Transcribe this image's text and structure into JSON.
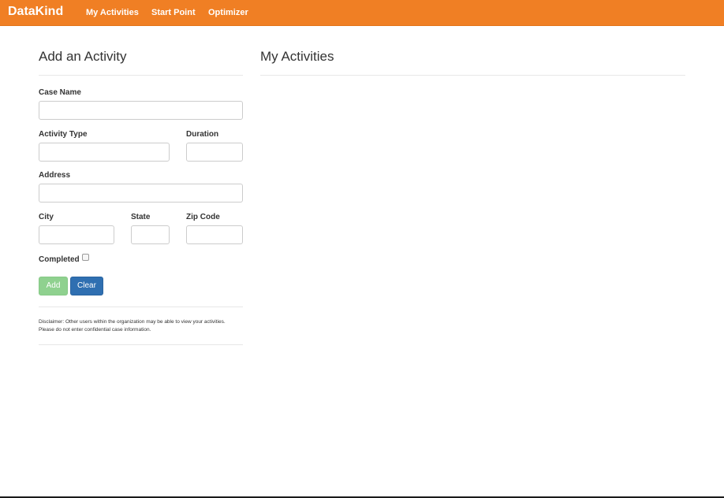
{
  "nav": {
    "brand": "DataKind",
    "links": [
      "My Activities",
      "Start Point",
      "Optimizer"
    ]
  },
  "form": {
    "title": "Add an Activity",
    "case_name_label": "Case Name",
    "case_name_value": "",
    "activity_type_label": "Activity Type",
    "activity_type_value": "",
    "duration_label": "Duration",
    "duration_value": "",
    "address_label": "Address",
    "address_value": "",
    "city_label": "City",
    "city_value": "",
    "state_label": "State",
    "state_value": "",
    "zip_label": "Zip Code",
    "zip_value": "",
    "completed_label": "Completed",
    "completed_checked": false,
    "add_label": "Add",
    "clear_label": "Clear",
    "disclaimer": "Disclaimer: Other users within the organization may be able to view your activities. Please do not enter confidential case information."
  },
  "activities": {
    "title": "My Activities",
    "items": []
  },
  "colors": {
    "navbar": "#f07f24",
    "add_button": "#8fd18f",
    "clear_button": "#2f6fb1"
  }
}
